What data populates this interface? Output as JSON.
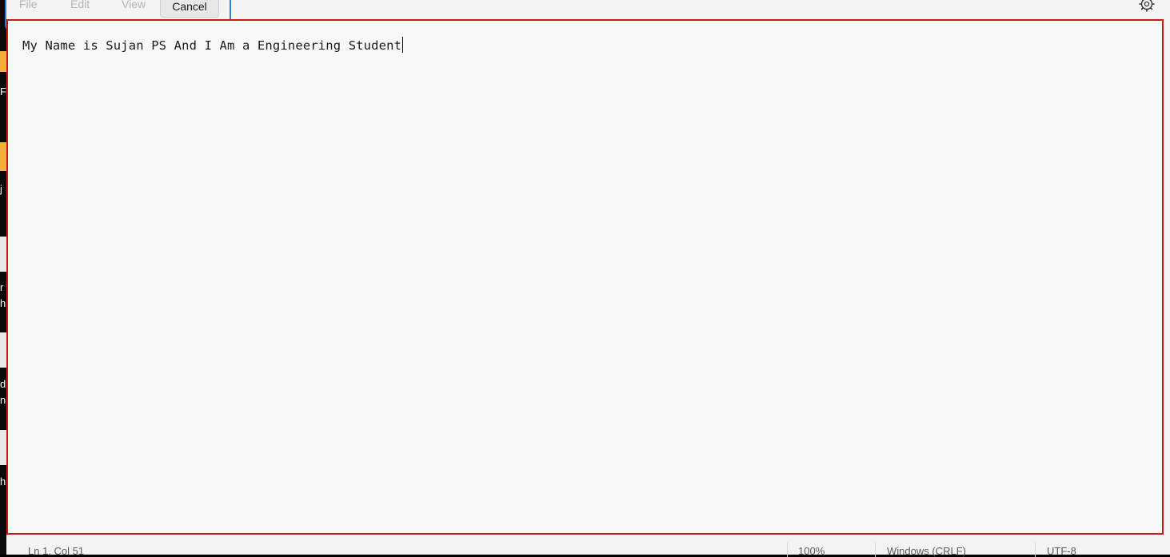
{
  "menu": {
    "file_label": "File",
    "edit_label": "Edit",
    "view_label": "View"
  },
  "dialog": {
    "cancel_label": "Cancel"
  },
  "editor": {
    "content": "My Name is Sujan PS And I Am a Engineering Student"
  },
  "status": {
    "position": "Ln 1, Col 51",
    "zoom": "100%",
    "line_ending": "Windows (CRLF)",
    "encoding": "UTF-8"
  },
  "desktop": {
    "glyphs": [
      "F",
      "j",
      "r",
      "h",
      "d",
      "n",
      "h"
    ]
  },
  "icons": {
    "settings": "gear-icon"
  },
  "colors": {
    "highlight_border": "#d0161b",
    "focus_border": "#2b7fd6",
    "editor_background": "#f8f8f8"
  }
}
